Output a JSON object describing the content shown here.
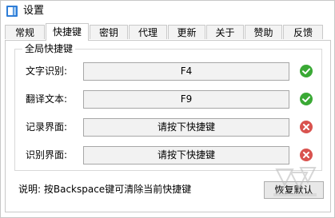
{
  "window": {
    "title": "设置",
    "icon": "app-icon"
  },
  "tabs": [
    {
      "label": "常规"
    },
    {
      "label": "快捷键",
      "active": true
    },
    {
      "label": "密钥"
    },
    {
      "label": "代理"
    },
    {
      "label": "更新"
    },
    {
      "label": "关于"
    },
    {
      "label": "赞助"
    },
    {
      "label": "反馈"
    }
  ],
  "shortcuts": {
    "group_title": "全局快捷键",
    "rows": [
      {
        "label": "文字识别:",
        "value": "F4",
        "status": "check-icon"
      },
      {
        "label": "翻译文本:",
        "value": "F9",
        "status": "check-icon"
      },
      {
        "label": "记录界面:",
        "value": "请按下快捷键",
        "status": "error-icon"
      },
      {
        "label": "识别界面:",
        "value": "请按下快捷键",
        "status": "error-icon"
      }
    ]
  },
  "footer": {
    "hint": "说明: 按Backspace键可清除当前快捷键",
    "reset_label": "恢复默认"
  },
  "colors": {
    "success": "#3aa935",
    "error": "#d9534f",
    "tab_border": "#c9c9c9"
  }
}
